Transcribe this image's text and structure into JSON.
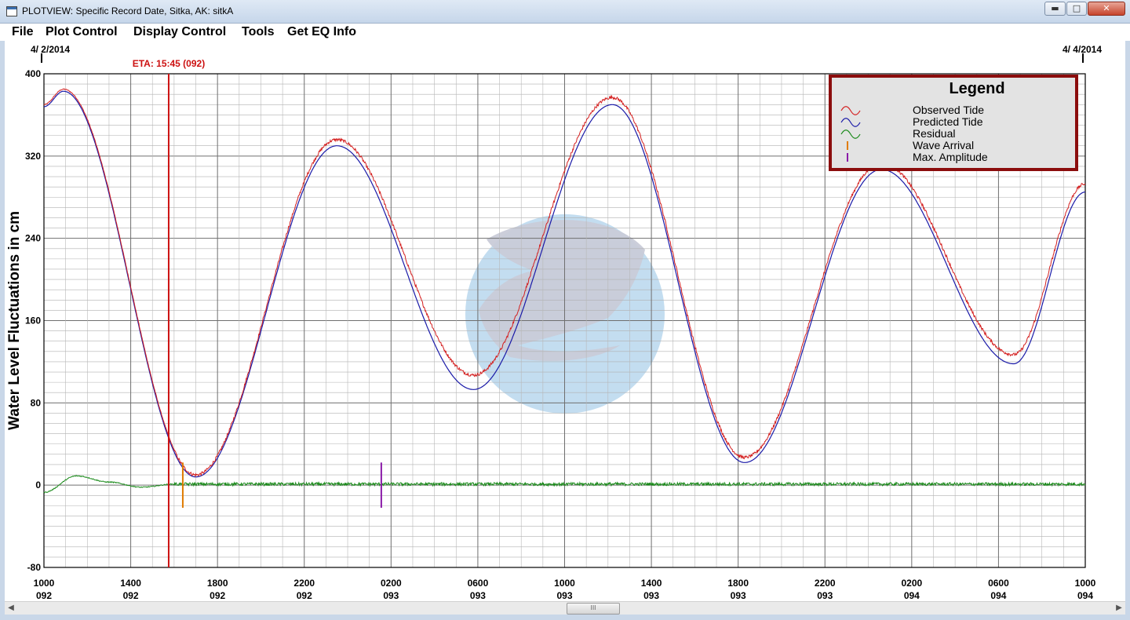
{
  "window": {
    "title": "PLOTVIEW: Specific Record Date, Sitka, AK: sitkA",
    "min_glyph": "▬",
    "max_glyph": "□",
    "close_glyph": "✕"
  },
  "menu": [
    "File",
    "Plot Control",
    "Display Control",
    "Tools",
    "Get EQ Info"
  ],
  "scroll": {
    "left_glyph": "◀",
    "right_glyph": "▶",
    "thumb_glyph": "III"
  },
  "chart_data": {
    "type": "line",
    "date_left": "4/ 2/2014",
    "date_right": "4/ 4/2014",
    "eta_label": "ETA: 15:45 (092)",
    "ylabel": "Water Level Fluctuations in cm",
    "ylim": [
      -80,
      400
    ],
    "yticks": [
      "400",
      "320",
      "240",
      "160",
      "80",
      "0",
      "-80"
    ],
    "xlim_hours": [
      0,
      48
    ],
    "xticks": [
      {
        "time": "1000",
        "day": "092"
      },
      {
        "time": "1400",
        "day": "092"
      },
      {
        "time": "1800",
        "day": "092"
      },
      {
        "time": "2200",
        "day": "092"
      },
      {
        "time": "0200",
        "day": "093"
      },
      {
        "time": "0600",
        "day": "093"
      },
      {
        "time": "1000",
        "day": "093"
      },
      {
        "time": "1400",
        "day": "093"
      },
      {
        "time": "1800",
        "day": "093"
      },
      {
        "time": "2200",
        "day": "093"
      },
      {
        "time": "0200",
        "day": "094"
      },
      {
        "time": "0600",
        "day": "094"
      },
      {
        "time": "1000",
        "day": "094"
      }
    ],
    "grid": true,
    "eta_hours": 5.75,
    "wave_arrival_hours": 6.4,
    "max_amplitude_hours": 15.55,
    "predicted_extrema": [
      {
        "hours": 0,
        "value": 368
      },
      {
        "hours": 0.9,
        "value": 383
      },
      {
        "hours": 7.0,
        "value": 8
      },
      {
        "hours": 13.5,
        "value": 330
      },
      {
        "hours": 19.8,
        "value": 93
      },
      {
        "hours": 26.2,
        "value": 370
      },
      {
        "hours": 32.3,
        "value": 22
      },
      {
        "hours": 38.6,
        "value": 307
      },
      {
        "hours": 44.7,
        "value": 118
      },
      {
        "hours": 48,
        "value": 285
      }
    ],
    "observed_extrema": [
      {
        "hours": 0,
        "value": 370
      },
      {
        "hours": 0.9,
        "value": 385
      },
      {
        "hours": 7.0,
        "value": 10
      },
      {
        "hours": 13.5,
        "value": 336
      },
      {
        "hours": 19.8,
        "value": 107
      },
      {
        "hours": 26.2,
        "value": 377
      },
      {
        "hours": 32.3,
        "value": 27
      },
      {
        "hours": 38.6,
        "value": 313
      },
      {
        "hours": 44.7,
        "value": 127
      },
      {
        "hours": 48,
        "value": 293
      }
    ],
    "residual_points": [
      {
        "hours": 0,
        "value": -7
      },
      {
        "hours": 1.5,
        "value": 9
      },
      {
        "hours": 3.0,
        "value": 3
      },
      {
        "hours": 4.5,
        "value": -2
      },
      {
        "hours": 6.0,
        "value": 1
      },
      {
        "hours": 48,
        "value": 1
      }
    ],
    "legend": {
      "title": "Legend",
      "position": "top-right",
      "entries": [
        {
          "label": "Observed Tide",
          "color": "#d42020",
          "glyph": "wave"
        },
        {
          "label": "Predicted Tide",
          "color": "#1a1aa8",
          "glyph": "wave"
        },
        {
          "label": "Residual",
          "color": "#1a8a1a",
          "glyph": "wave"
        },
        {
          "label": "Wave Arrival",
          "color": "#e07b00",
          "glyph": "bar"
        },
        {
          "label": "Max. Amplitude",
          "color": "#8a1aa8",
          "glyph": "bar"
        }
      ]
    },
    "colors": {
      "observed": "#d42020",
      "predicted": "#1a1aa8",
      "residual": "#1a8a1a",
      "eta": "#cc1111",
      "wave_arrival": "#e07b00",
      "max_amplitude": "#8a1aa8",
      "legend_border": "#8b0d0d",
      "watermark_gray": "#c9cbd8",
      "watermark_blue": "#bcd9ee"
    }
  }
}
